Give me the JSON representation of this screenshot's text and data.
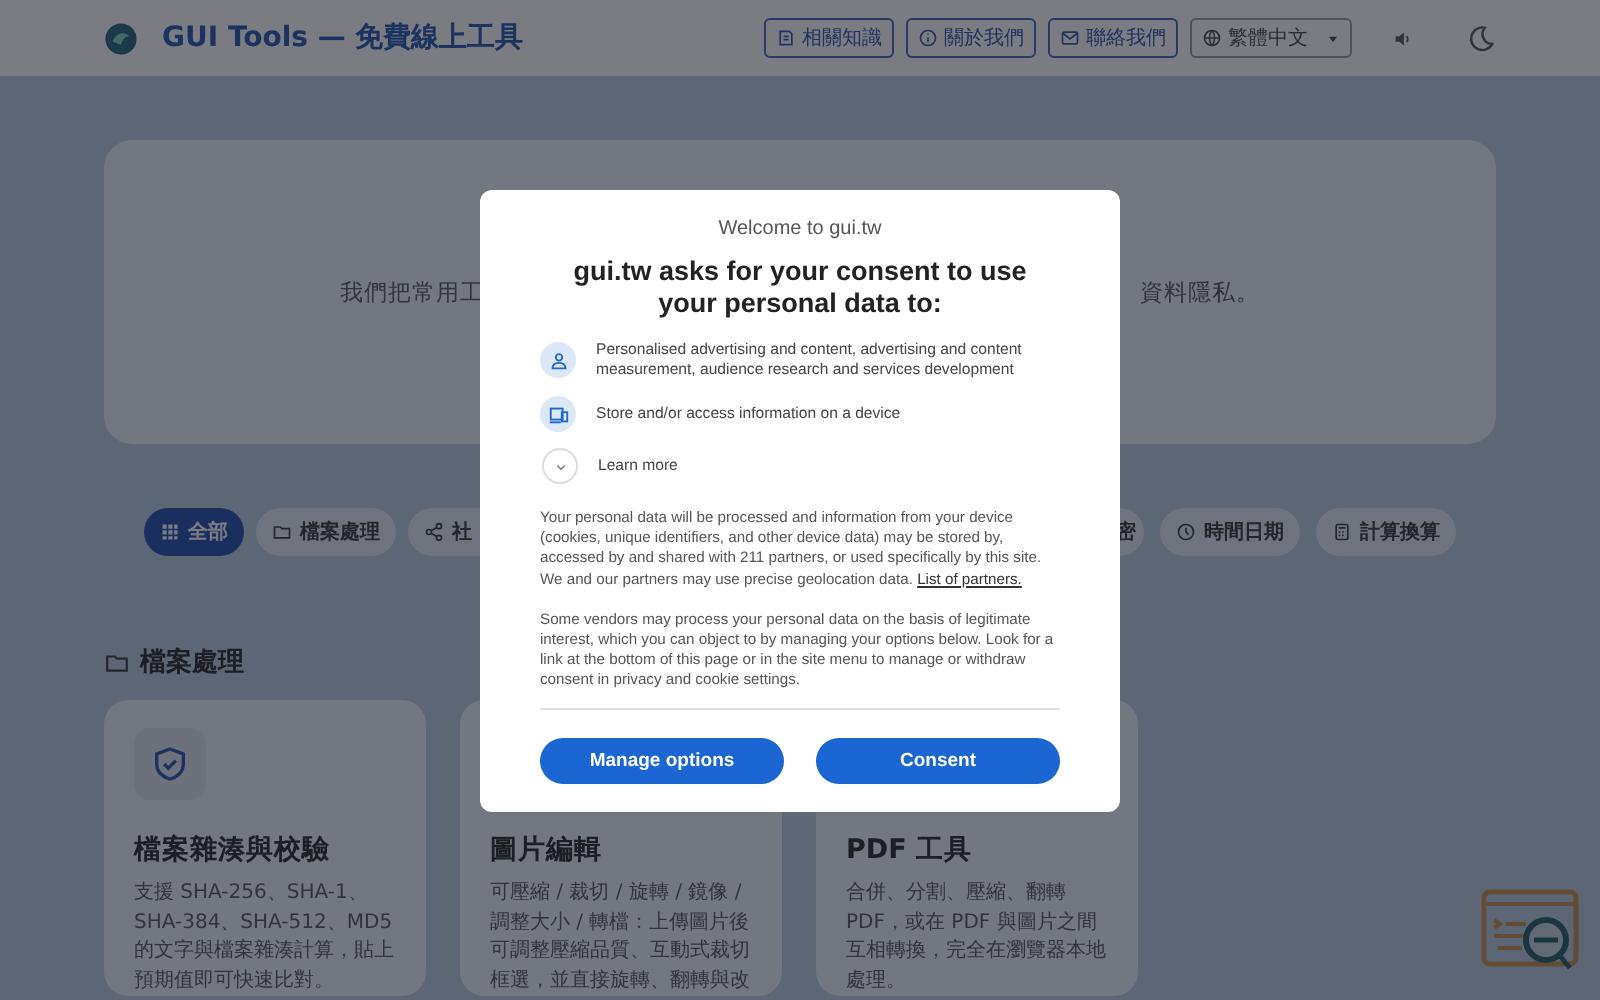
{
  "header": {
    "title": "GUI Tools — 免費線上工具",
    "nav": [
      {
        "label": "相關知識"
      },
      {
        "label": "關於我們"
      },
      {
        "label": "聯絡我們"
      }
    ],
    "language": {
      "label": "繁體中文"
    }
  },
  "hero": {
    "text_left": "我們把常用工",
    "text_right": "資料隱私。"
  },
  "categories": [
    {
      "label": "全部",
      "selected": true
    },
    {
      "label": "檔案處理",
      "selected": false
    },
    {
      "label": "社",
      "selected": false
    },
    {
      "label": "密",
      "selected": false
    },
    {
      "label": "時間日期",
      "selected": false
    },
    {
      "label": "計算換算",
      "selected": false
    }
  ],
  "section": {
    "title": "檔案處理"
  },
  "cards": [
    {
      "title": "檔案雜湊與校驗",
      "description": "支援 SHA-256、SHA-1、SHA-384、SHA-512、MD5 的文字與檔案雜湊計算，貼上預期值即可快速比對。"
    },
    {
      "title": "圖片編輯",
      "description": "可壓縮 / 裁切 / 旋轉 / 鏡像 / 調整大小 / 轉檔：上傳圖片後可調整壓縮品質、互動式裁切框選，並直接旋轉、翻轉與改"
    },
    {
      "title": "PDF 工具",
      "description": "合併、分割、壓縮、翻轉 PDF，或在 PDF 與圖片之間互相轉換，完全在瀏覽器本地處理。"
    }
  ],
  "consent": {
    "welcome": "Welcome to gui.tw",
    "heading": "gui.tw asks for your consent to use your personal data to:",
    "purposes": [
      {
        "text": "Personalised advertising and content, advertising and content measurement, audience research and services development"
      },
      {
        "text": "Store and/or access information on a device"
      }
    ],
    "learn_more": "Learn more",
    "paragraphs": [
      "Your personal data will be processed and information from your device (cookies, unique identifiers, and other device data) may be stored by, accessed by and shared with 211 partners, or used specifically by this site. We and our partners may use precise geolocation data.",
      "Some vendors may process your personal data on the basis of legitimate interest, which you can object to by managing your options below. Look for a link at the bottom of this page or in the site menu to manage or withdraw consent in privacy and cookie settings."
    ],
    "partners_link": "List of partners.",
    "buttons": [
      "Manage options",
      "Consent"
    ]
  }
}
